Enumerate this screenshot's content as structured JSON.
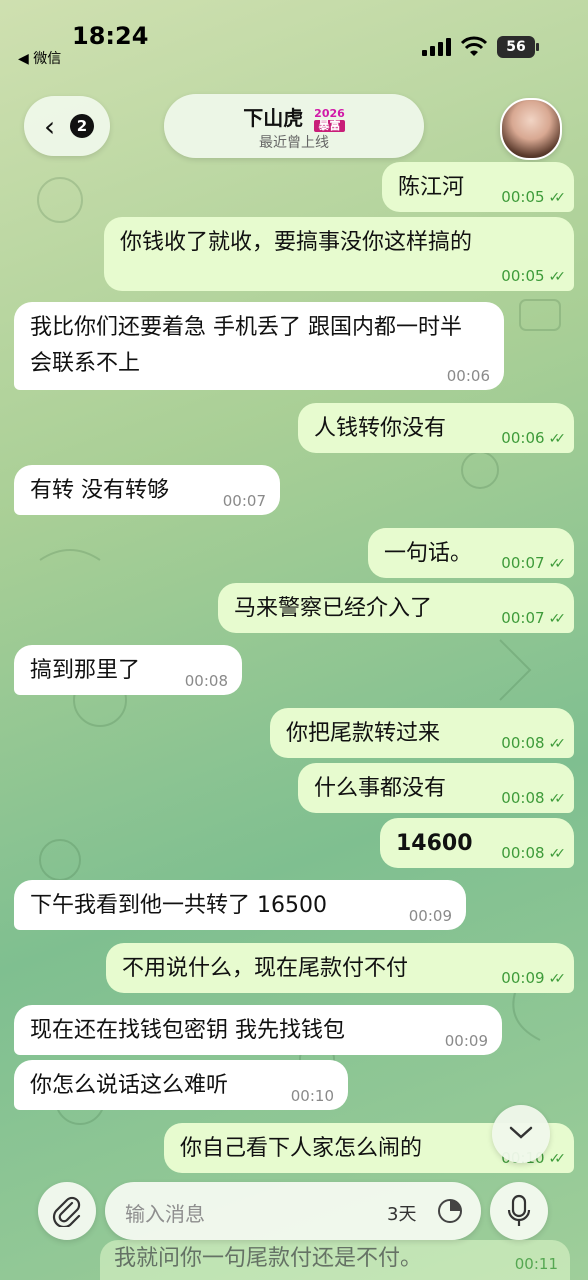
{
  "status_bar": {
    "time": "18:24",
    "back_app": "◀ 微信",
    "battery": "56"
  },
  "header": {
    "back_count": "2",
    "title": "下山虎",
    "badge_top": "2026",
    "badge_bottom": "暴富",
    "subtitle": "最近曾上线"
  },
  "messages": [
    {
      "dir": "out",
      "text": "陈江河",
      "time": "00:05"
    },
    {
      "dir": "out",
      "text": "你钱收了就收，要搞事没你这样搞的",
      "time": "00:05"
    },
    {
      "dir": "in",
      "text": "我比你们还要着急  手机丢了 跟国内都一时半会联系不上",
      "time": "00:06"
    },
    {
      "dir": "out",
      "text": "人钱转你没有",
      "time": "00:06"
    },
    {
      "dir": "in",
      "text": "有转  没有转够",
      "time": "00:07"
    },
    {
      "dir": "out",
      "text": "一句话。",
      "time": "00:07"
    },
    {
      "dir": "out",
      "text": "马来警察已经介入了",
      "time": "00:07"
    },
    {
      "dir": "in",
      "text": "搞到那里了",
      "time": "00:08"
    },
    {
      "dir": "out",
      "text": "你把尾款转过来",
      "time": "00:08"
    },
    {
      "dir": "out",
      "text": "什么事都没有",
      "time": "00:08"
    },
    {
      "dir": "out",
      "text": "14600",
      "time": "00:08"
    },
    {
      "dir": "in",
      "text": "下午我看到他一共转了 16500",
      "time": "00:09"
    },
    {
      "dir": "out",
      "text": "不用说什么，现在尾款付不付",
      "time": "00:09"
    },
    {
      "dir": "in",
      "text": "现在还在找钱包密钥  我先找钱包",
      "time": "00:09"
    },
    {
      "dir": "in",
      "text": "你怎么说话这么难听",
      "time": "00:10"
    },
    {
      "dir": "out",
      "text": "你自己看下人家怎么闹的",
      "time": "00:10"
    }
  ],
  "ghost_message": {
    "text": "我就问你一句尾款付还是不付。",
    "time": "00:11"
  },
  "composer": {
    "placeholder": "输入消息",
    "timer": "3天"
  },
  "colors": {
    "outgoing_bubble": "#e7fbcf",
    "incoming_bubble": "#ffffff",
    "time_green": "#3e9b3a"
  }
}
